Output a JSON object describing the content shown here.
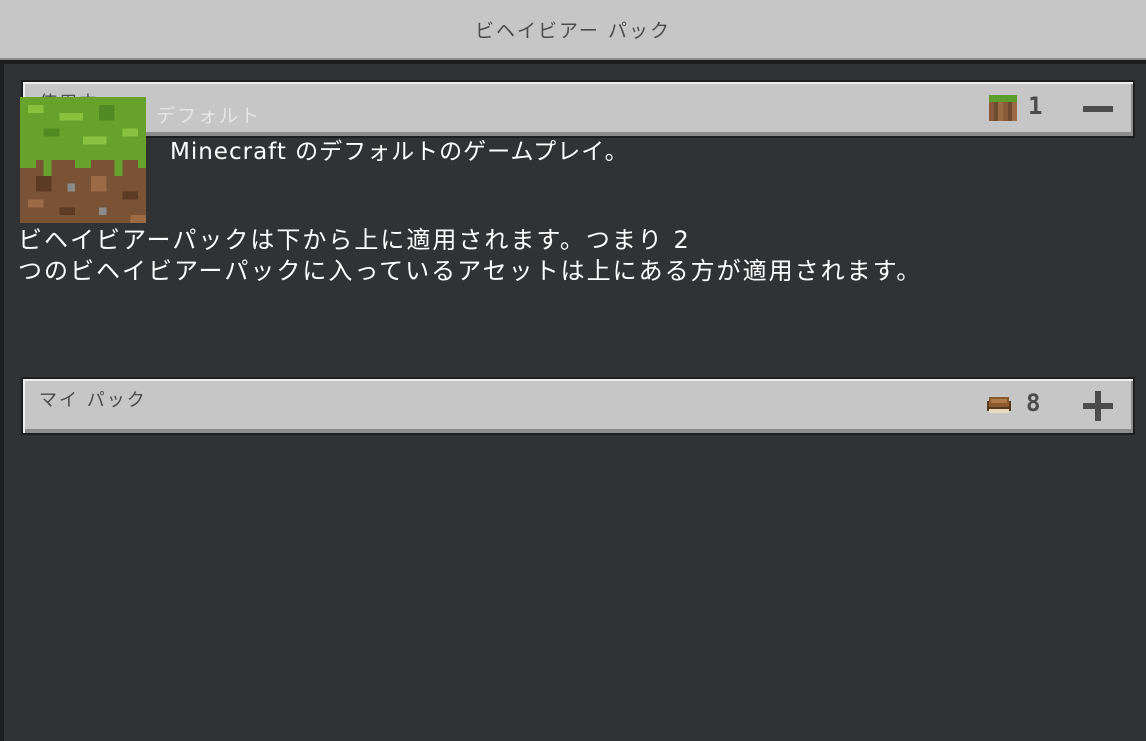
{
  "window": {
    "title": "ビヘイビアー パック"
  },
  "active_section": {
    "label": "使用中",
    "count": "1",
    "count_icon": "grass-block-icon",
    "action": "collapse-minus-icon"
  },
  "active_pack": {
    "name": "デフォルト",
    "description": "Minecraft のデフォルトのゲームプレイ。",
    "thumbnail_icon": "grass-block-icon"
  },
  "info": {
    "line1": "ビヘイビアーパックは下から上に適用されます。つまり 2",
    "line2": "つのビヘイビアーパックに入っているアセットは上にある方が適用されます。"
  },
  "my_packs_section": {
    "label": "マイ パック",
    "count": "8",
    "count_icon": "book-icon",
    "action": "expand-plus-icon"
  },
  "colors": {
    "background": "#313233",
    "header_bg": "#c6c6c6",
    "header_text": "#4c4c4c",
    "body_text": "#ffffff"
  }
}
